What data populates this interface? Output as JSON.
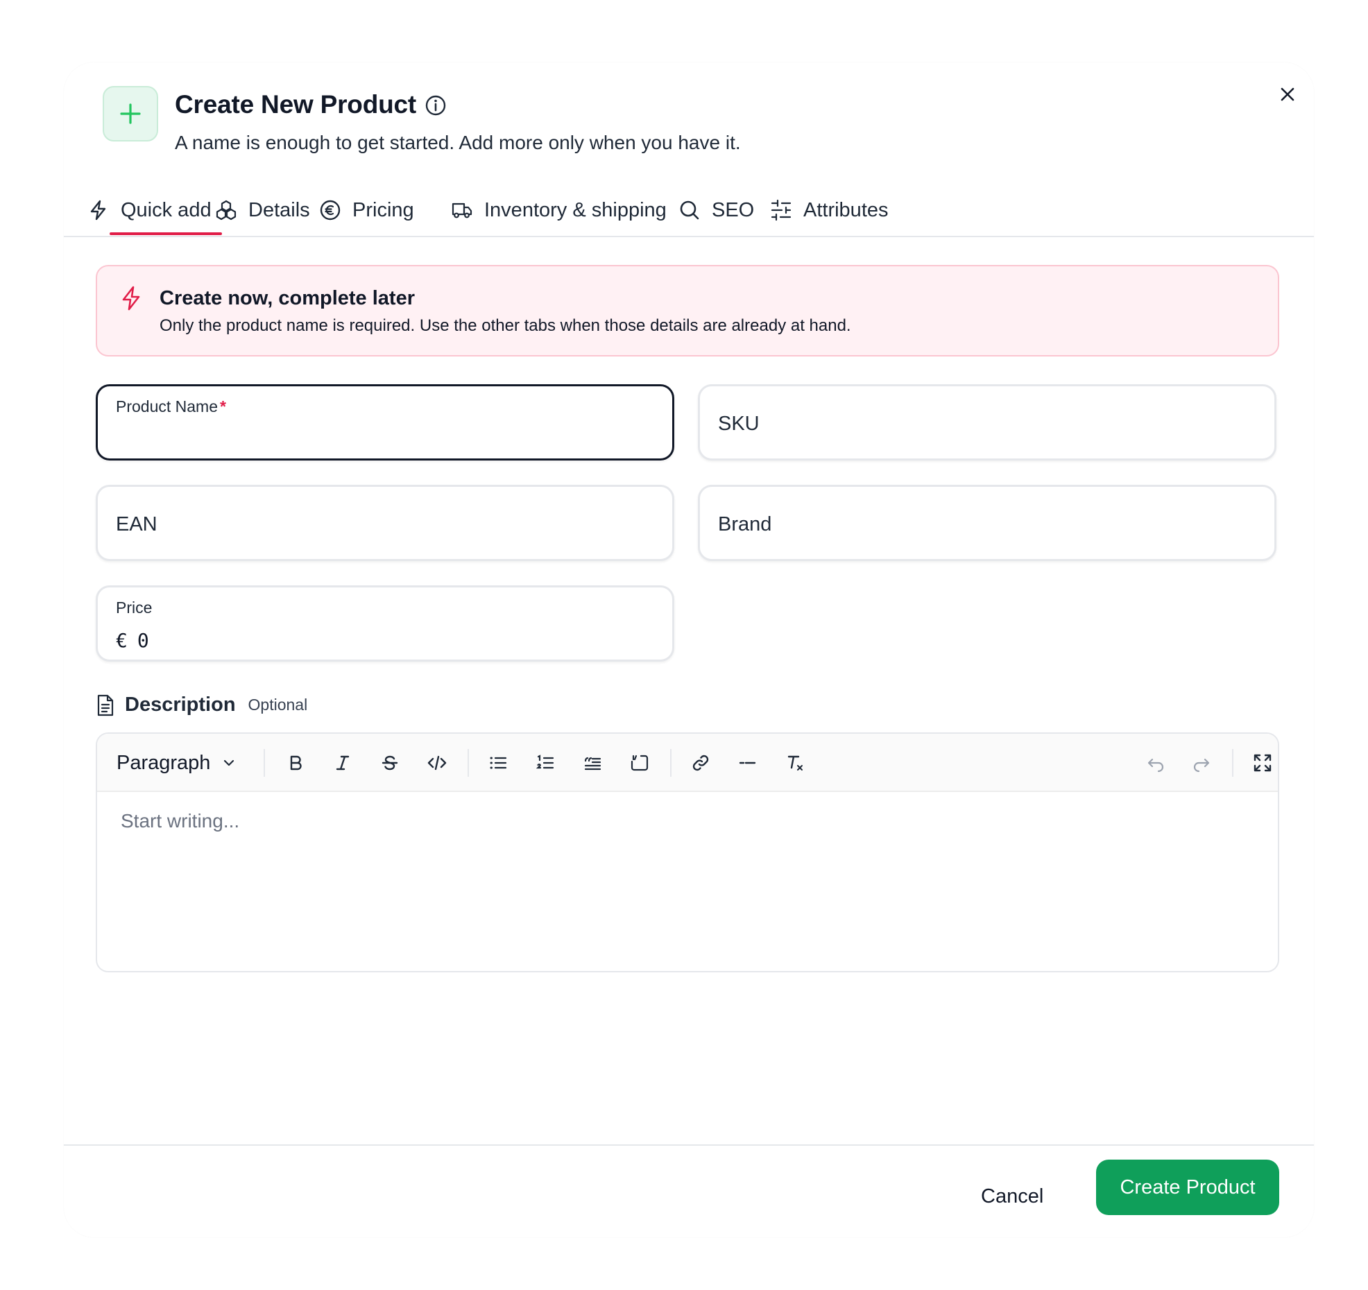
{
  "header": {
    "title": "Create New Product",
    "subtitle": "A name is enough to get started. Add more only when you have it."
  },
  "tabs": [
    {
      "label": "Quick add",
      "icon": "bolt-icon",
      "active": true
    },
    {
      "label": "Details",
      "icon": "cubes-icon"
    },
    {
      "label": "Pricing",
      "icon": "euro-icon"
    },
    {
      "label": "Inventory & shipping",
      "icon": "truck-icon"
    },
    {
      "label": "SEO",
      "icon": "search-icon"
    },
    {
      "label": "Attributes",
      "icon": "sliders-icon"
    }
  ],
  "alert": {
    "title": "Create now, complete later",
    "body": "Only the product name is required. Use the other tabs when those details are already at hand."
  },
  "fields": {
    "product_name": {
      "label": "Product Name",
      "required_mark": "*",
      "value": ""
    },
    "sku": {
      "label": "SKU"
    },
    "ean": {
      "label": "EAN"
    },
    "brand": {
      "label": "Brand"
    },
    "price": {
      "label": "Price",
      "currency": "€",
      "value": "0"
    }
  },
  "description": {
    "title": "Description",
    "optional": "Optional",
    "paragraph_select": "Paragraph",
    "placeholder": "Start writing..."
  },
  "footer": {
    "cancel": "Cancel",
    "create": "Create Product"
  },
  "colors": {
    "accent": "#e11d48",
    "primary": "#0f9f5a",
    "badge_bg": "#e6f7ee",
    "alert_bg": "#fff1f4"
  }
}
